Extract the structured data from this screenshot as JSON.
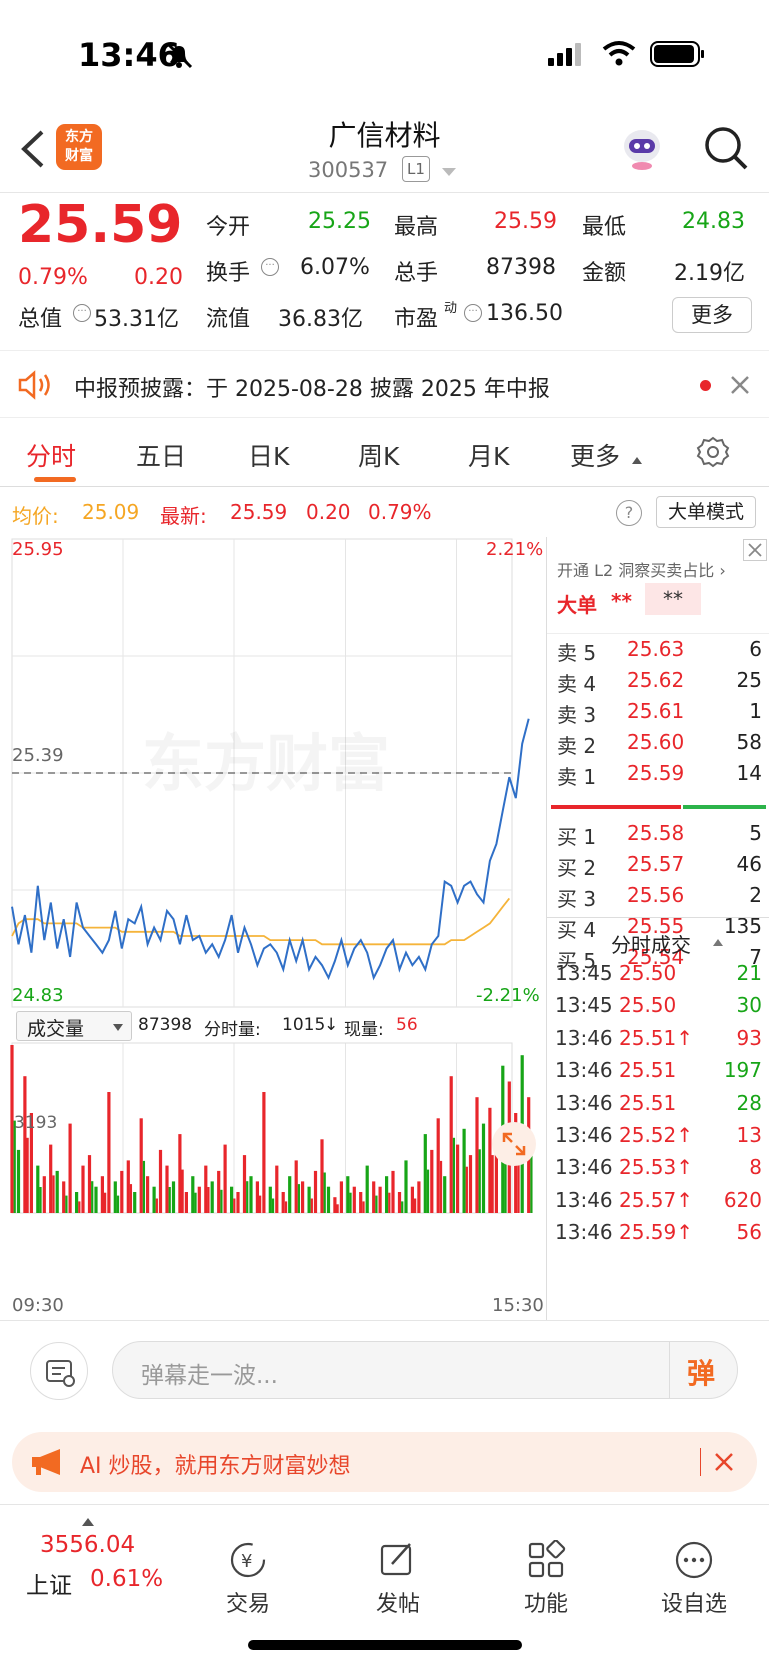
{
  "status": {
    "time": "13:46"
  },
  "header": {
    "logo": "东方财富",
    "title": "广信材料",
    "code": "300537",
    "level": "L1"
  },
  "quote": {
    "price": "25.59",
    "change_pct": "0.79%",
    "change": "0.20",
    "open_label": "今开",
    "open": "25.25",
    "high_label": "最高",
    "high": "25.59",
    "low_label": "最低",
    "low": "24.83",
    "turnover_label": "换手",
    "turnover": "6.07%",
    "volume_label": "总手",
    "volume": "87398",
    "amount_label": "金额",
    "amount": "2.19亿",
    "mcap_label": "总值",
    "mcap": "53.31亿",
    "float_label": "流值",
    "float": "36.83亿",
    "pe_label": "市盈",
    "pe_sup": "动",
    "pe": "136.50",
    "more": "更多"
  },
  "notice": {
    "text": "中报预披露：于 2025-08-28 披露 2025 年中报"
  },
  "tabs": [
    "分时",
    "五日",
    "日K",
    "周K",
    "月K",
    "更多"
  ],
  "infobar": {
    "avg_label": "均价:",
    "avg": "25.09",
    "latest_label": "最新:",
    "latest": "25.59",
    "chg": "0.20",
    "pct": "0.79%",
    "mode": "大单模式"
  },
  "chart": {
    "price_high": "25.95",
    "price_low": "24.83",
    "pct_high": "2.21%",
    "pct_low": "-2.21%",
    "preclose": "25.39",
    "watermark": "东方财富",
    "vol_selector": "成交量",
    "vol_info_total": "87398",
    "vol_info_label": "分时量:",
    "vol_info_value": "1015",
    "vol_info_arrow": "↓",
    "cur_label": "现量:",
    "cur_value": "56",
    "vol_max": "3193",
    "time_start": "09:30",
    "time_end": "15:30"
  },
  "chart_data": {
    "type": "line",
    "ylim": [
      24.83,
      25.95
    ],
    "preclose": 25.39,
    "series": [
      {
        "name": "最新",
        "values": [
          25.07,
          24.98,
          25.05,
          24.96,
          25.12,
          24.99,
          25.08,
          24.97,
          25.04,
          24.95,
          25.08,
          25.02,
          25.0,
          24.98,
          24.96,
          24.99,
          25.06,
          24.97,
          25.04,
          25.03,
          25.07,
          24.98,
          25.02,
          24.99,
          25.06,
          25.04,
          24.98,
          25.05,
          24.99,
          25.0,
          24.96,
          24.98,
          24.95,
          24.99,
          25.05,
          24.96,
          25.02,
          24.98,
          24.93,
          24.97,
          24.98,
          24.96,
          24.92,
          24.99,
          24.94,
          24.99,
          24.92,
          24.95,
          24.93,
          24.9,
          24.94,
          24.99,
          24.93,
          24.97,
          24.99,
          24.96,
          24.9,
          24.93,
          24.97,
          24.99,
          24.92,
          24.96,
          24.93,
          24.95,
          24.92,
          24.98,
          25.0,
          25.13,
          25.12,
          25.08,
          25.12,
          25.13,
          25.1,
          25.08,
          25.18,
          25.22,
          25.3,
          25.38,
          25.33,
          25.46,
          25.52
        ]
      },
      {
        "name": "均价",
        "values": [
          25.0,
          25.03,
          25.04,
          25.04,
          25.04,
          25.03,
          25.03,
          25.03,
          25.03,
          25.03,
          25.03,
          25.02,
          25.02,
          25.02,
          25.02,
          25.02,
          25.02,
          25.01,
          25.01,
          25.01,
          25.01,
          25.01,
          25.01,
          25.01,
          25.01,
          25.01,
          25.0,
          25.0,
          25.0,
          25.0,
          25.0,
          25.0,
          25.0,
          25.0,
          25.0,
          25.0,
          25.0,
          25.0,
          25.0,
          25.0,
          24.99,
          24.99,
          24.99,
          24.99,
          24.99,
          24.99,
          24.99,
          24.99,
          24.98,
          24.98,
          24.98,
          24.98,
          24.98,
          24.98,
          24.98,
          24.98,
          24.98,
          24.98,
          24.98,
          24.98,
          24.98,
          24.98,
          24.98,
          24.98,
          24.98,
          24.98,
          24.98,
          24.98,
          24.99,
          24.99,
          24.99,
          25.0,
          25.01,
          25.02,
          25.03,
          25.05,
          25.07,
          25.09
        ]
      }
    ],
    "volume": [
      3193,
      1200,
      2600,
      1900,
      900,
      700,
      1300,
      800,
      600,
      1700,
      400,
      900,
      1100,
      500,
      700,
      2300,
      600,
      800,
      1000,
      400,
      1800,
      700,
      500,
      1200,
      900,
      600,
      1500,
      400,
      700,
      500,
      900,
      600,
      800,
      1300,
      500,
      400,
      1100,
      700,
      600,
      2300,
      500,
      900,
      400,
      700,
      1000,
      600,
      500,
      800,
      1400,
      500,
      300,
      600,
      700,
      500,
      400,
      900,
      600,
      500,
      700,
      800,
      400,
      1000,
      500,
      600,
      1500,
      1200,
      1800,
      700,
      2600,
      1300,
      1600,
      1100,
      2200,
      1700,
      2000,
      1400,
      2800,
      2500,
      1900,
      3000,
      2200
    ],
    "volume_colors": "mixed red/green per bar"
  },
  "side": {
    "l2": "开通 L2 洞察买卖占比 ›",
    "big": "大单",
    "big_v1": "**",
    "big_v2": "**",
    "asks": [
      {
        "label": "卖 5",
        "price": "25.63",
        "vol": "6"
      },
      {
        "label": "卖 4",
        "price": "25.62",
        "vol": "25"
      },
      {
        "label": "卖 3",
        "price": "25.61",
        "vol": "1"
      },
      {
        "label": "卖 2",
        "price": "25.60",
        "vol": "58"
      },
      {
        "label": "卖 1",
        "price": "25.59",
        "vol": "14"
      }
    ],
    "bids": [
      {
        "label": "买 1",
        "price": "25.58",
        "vol": "5"
      },
      {
        "label": "买 2",
        "price": "25.57",
        "vol": "46"
      },
      {
        "label": "买 3",
        "price": "25.56",
        "vol": "2"
      },
      {
        "label": "买 4",
        "price": "25.55",
        "vol": "135"
      },
      {
        "label": "买 5",
        "price": "25.54",
        "vol": "7"
      }
    ],
    "ticks_title": "分时成交",
    "ticks": [
      {
        "t": "13:45",
        "p": "25.50",
        "v": "21",
        "c": "green"
      },
      {
        "t": "13:45",
        "p": "25.50",
        "v": "30",
        "c": "green"
      },
      {
        "t": "13:46",
        "p": "25.51↑",
        "v": "93",
        "c": "red"
      },
      {
        "t": "13:46",
        "p": "25.51",
        "v": "197",
        "c": "green"
      },
      {
        "t": "13:46",
        "p": "25.51",
        "v": "28",
        "c": "green"
      },
      {
        "t": "13:46",
        "p": "25.52↑",
        "v": "13",
        "c": "red"
      },
      {
        "t": "13:46",
        "p": "25.53↑",
        "v": "8",
        "c": "red"
      },
      {
        "t": "13:46",
        "p": "25.57↑",
        "v": "620",
        "c": "red"
      },
      {
        "t": "13:46",
        "p": "25.59↑",
        "v": "56",
        "c": "red"
      }
    ]
  },
  "bottom": {
    "danmu_placeholder": "弹幕走一波...",
    "danmu_btn": "弹",
    "ad": "AI 炒股，就用东方财富妙想",
    "index_value": "3556.04",
    "index_name": "上证",
    "index_pct": "0.61%",
    "nav": [
      "交易",
      "发帖",
      "功能",
      "设自选"
    ]
  },
  "colors": {
    "red": "#e8262b",
    "green": "#17a517",
    "orange": "#f26a22",
    "blue": "#2f6fc7",
    "avg": "#f5b43a"
  }
}
